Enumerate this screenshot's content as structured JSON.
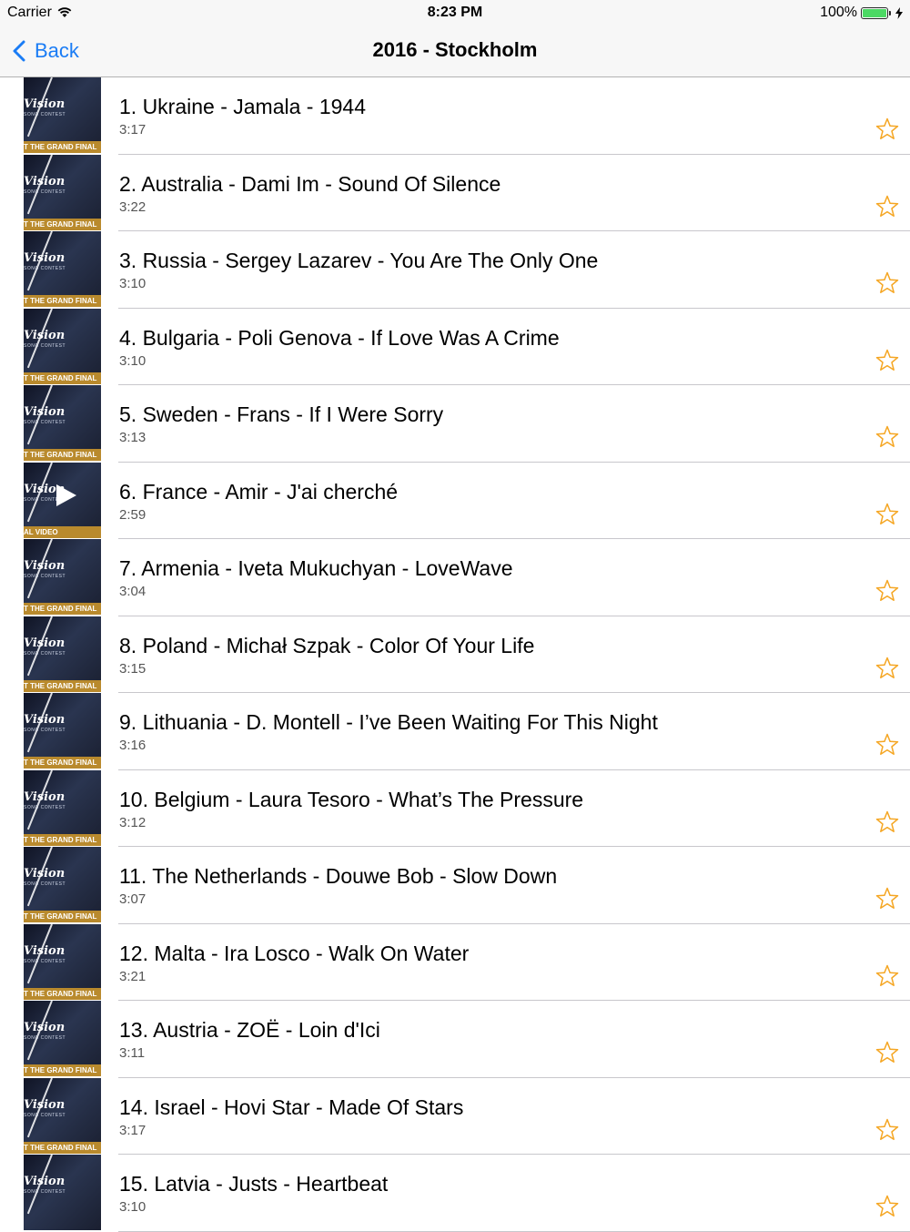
{
  "status": {
    "carrier": "Carrier",
    "time": "8:23 PM",
    "battery": "100%",
    "battery_level": 1.0
  },
  "nav": {
    "back_label": "Back",
    "title": "2016 - Stockholm"
  },
  "colors": {
    "accent": "#1a7cf5",
    "star": "#f5a623",
    "band_gold": "#b98a2d"
  },
  "thumb_text": {
    "logo": "Vision",
    "logo_sub": "SONG CONTEST",
    "band_final": "T THE GRAND FINAL",
    "band_video": "AL VIDEO"
  },
  "songs": [
    {
      "title": "1. Ukraine - Jamala - 1944",
      "duration": "3:17",
      "band": "final"
    },
    {
      "title": "2. Australia - Dami Im - Sound Of Silence",
      "duration": "3:22",
      "band": "final"
    },
    {
      "title": "3. Russia - Sergey Lazarev - You Are The Only One",
      "duration": "3:10",
      "band": "final"
    },
    {
      "title": "4. Bulgaria - Poli Genova - If Love Was A Crime",
      "duration": "3:10",
      "band": "final"
    },
    {
      "title": "5. Sweden - Frans - If I Were Sorry",
      "duration": "3:13",
      "band": "final"
    },
    {
      "title": "6. France - Amir - J'ai cherché",
      "duration": "2:59",
      "band": "video"
    },
    {
      "title": "7. Armenia - Iveta Mukuchyan - LoveWave",
      "duration": "3:04",
      "band": "final"
    },
    {
      "title": "8. Poland - Michał Szpak - Color Of Your Life",
      "duration": "3:15",
      "band": "final"
    },
    {
      "title": "9. Lithuania - D. Montell - I’ve Been Waiting For This Night",
      "duration": "3:16",
      "band": "final"
    },
    {
      "title": "10. Belgium - Laura Tesoro - What’s The Pressure",
      "duration": "3:12",
      "band": "final"
    },
    {
      "title": "11. The Netherlands - Douwe Bob - Slow Down",
      "duration": "3:07",
      "band": "final"
    },
    {
      "title": "12. Malta - Ira Losco - Walk On Water",
      "duration": "3:21",
      "band": "final"
    },
    {
      "title": "13. Austria - ZOË - Loin d'Ici",
      "duration": "3:11",
      "band": "final"
    },
    {
      "title": "14. Israel - Hovi Star - Made Of Stars",
      "duration": "3:17",
      "band": "final"
    },
    {
      "title": "15. Latvia - Justs - Heartbeat",
      "duration": "3:10",
      "band": "none"
    }
  ]
}
